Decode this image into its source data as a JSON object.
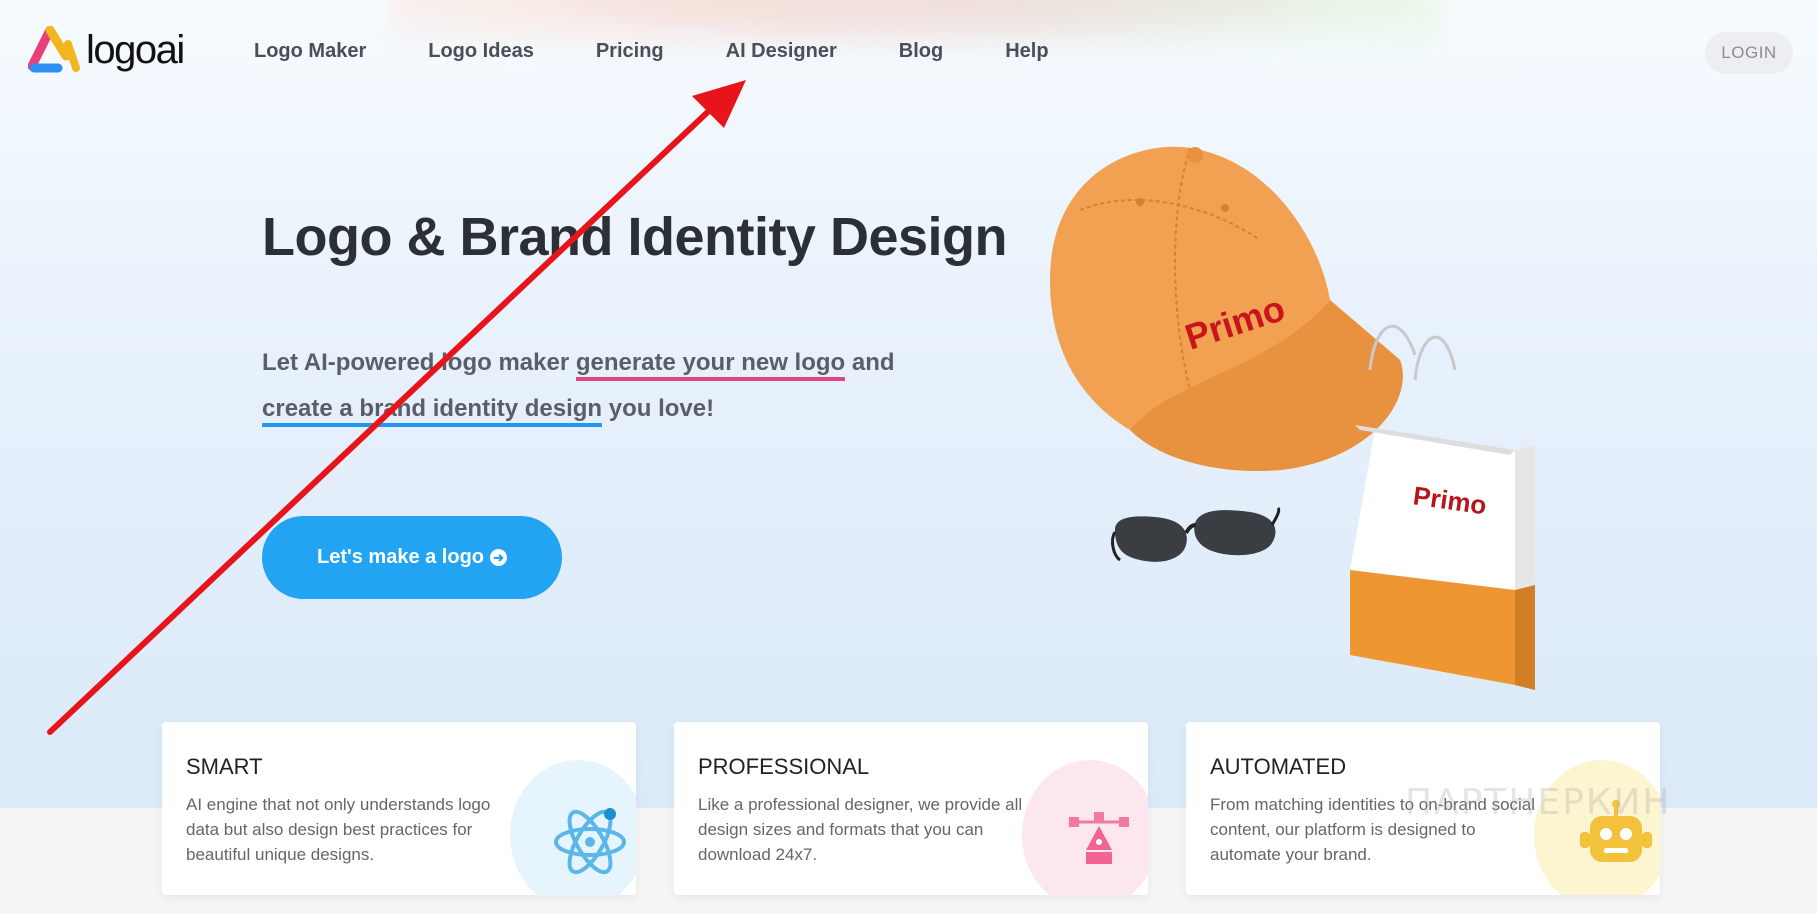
{
  "brand": {
    "name": "logoai"
  },
  "nav": {
    "items": [
      {
        "label": "Logo Maker"
      },
      {
        "label": "Logo Ideas"
      },
      {
        "label": "Pricing"
      },
      {
        "label": "AI Designer"
      },
      {
        "label": "Blog"
      },
      {
        "label": "Help"
      }
    ],
    "login_label": "LOGIN"
  },
  "hero": {
    "title": "Logo & Brand Identity Design",
    "subtitle_part1": "Let AI-powered logo maker ",
    "subtitle_highlight1": "generate your new logo",
    "subtitle_part2": " and ",
    "subtitle_highlight2": "create a brand identity design",
    "subtitle_part3": " you love!",
    "cta_label": "Let's make a logo"
  },
  "products": {
    "cap_brand": "Primo",
    "bag_brand": "Primo"
  },
  "cards": [
    {
      "title": "SMART",
      "text": "AI engine that not only understands logo data but also design best practices for beautiful unique designs.",
      "icon": "atom-icon"
    },
    {
      "title": "PROFESSIONAL",
      "text": "Like a professional designer, we provide all design sizes and formats that you can download 24x7.",
      "icon": "pen-tool-icon"
    },
    {
      "title": "AUTOMATED",
      "text": "From matching identities to on-brand social content, our platform is designed to automate your brand.",
      "icon": "robot-icon"
    }
  ],
  "watermark": "ПАРТНЕРКИН",
  "colors": {
    "accent_blue": "#22a4f2",
    "highlight_pink": "#e0457b",
    "highlight_blue": "#2196f3",
    "annotation_red": "#e8141b"
  }
}
